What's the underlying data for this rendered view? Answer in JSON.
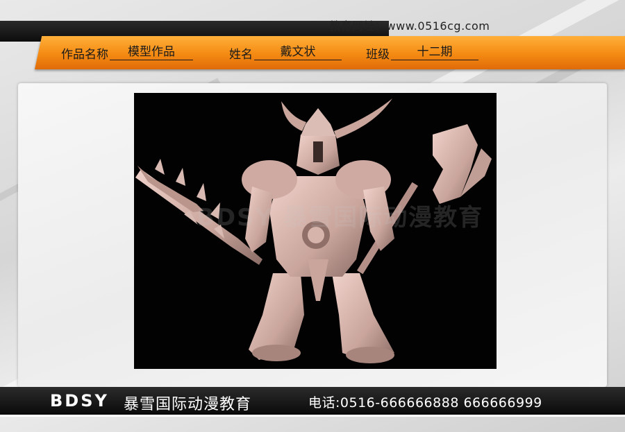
{
  "header": {
    "website_label": "教育网址：",
    "website_url": "www.0516cg.com"
  },
  "banner": {
    "work_name_label": "作品名称",
    "work_name_value": "模型作品",
    "name_label": "姓名",
    "name_value": "戴文状",
    "class_label": "班级",
    "class_value": "十二期"
  },
  "render": {
    "subject": "warrior-3d-model",
    "watermark": "BDSY 暴雪国际动漫教育"
  },
  "footer": {
    "logo": "BDSY",
    "school_name": "暴雪国际动漫教育",
    "phone": "电话:0516-666666888  666666999"
  },
  "colors": {
    "banner_orange": "#f48a12",
    "bar_black": "#0a0a0a",
    "model_tone": "#d8b8b0"
  }
}
